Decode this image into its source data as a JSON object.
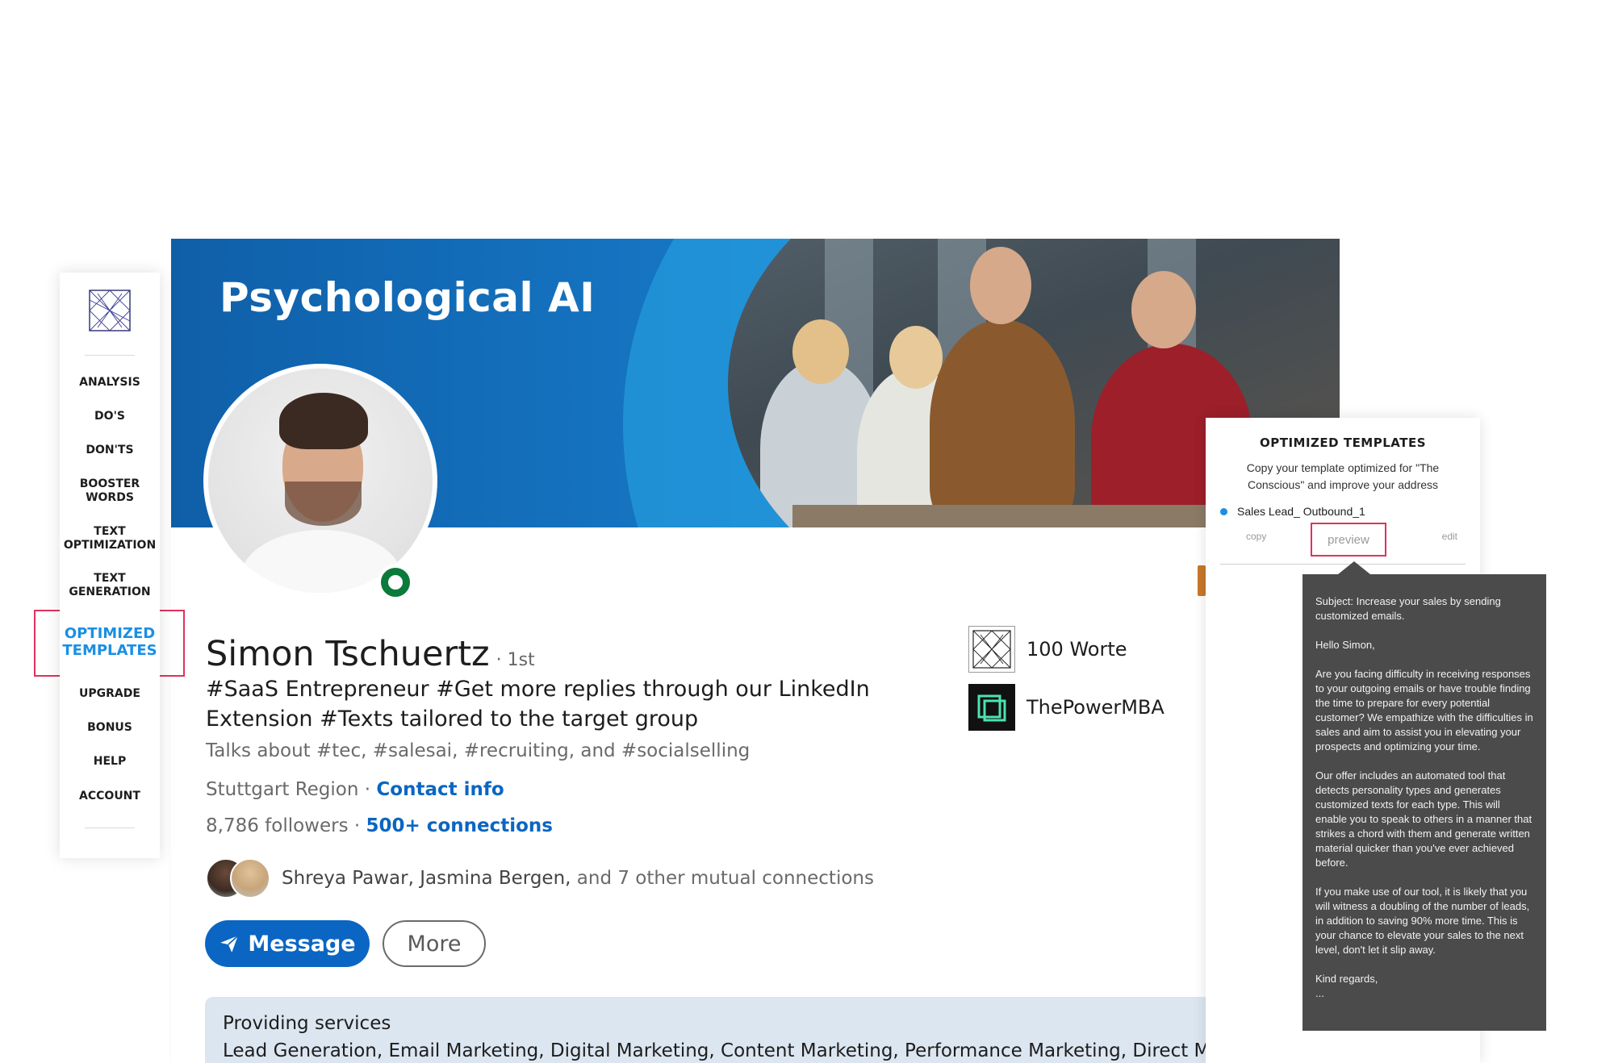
{
  "banner": {
    "title": "Psychological AI"
  },
  "profile": {
    "name": "Simon Tschuertz",
    "degree": "· 1st",
    "headline": "#SaaS Entrepreneur #Get more replies through our LinkedIn Extension #Texts tailored to the target group",
    "talks_about": "Talks about #tec, #salesai, #recruiting, and #socialselling",
    "location": "Stuttgart Region ·",
    "contact_info": "Contact info",
    "followers": "8,786 followers",
    "connections_sep": "·",
    "connections": "500+ connections",
    "mutual_names": "Shreya Pawar, Jasmina Bergen,",
    "mutual_rest": "and 7 other mutual connections",
    "message_button": "Message",
    "more_button": "More",
    "online_status_color": "#0b7a3b"
  },
  "companies": [
    {
      "name": "100 Worte",
      "icon": "worte-logo-icon"
    },
    {
      "name": "ThePowerMBA",
      "icon": "powermba-logo-icon"
    }
  ],
  "services": {
    "title": "Providing services",
    "list": "Lead Generation, Email Marketing, Digital Marketing, Content Marketing, Performance Marketing, Direct Mail M"
  },
  "sidebar": {
    "items": [
      {
        "label": "ANALYSIS"
      },
      {
        "label": "DO'S"
      },
      {
        "label": "DON'TS"
      },
      {
        "label": "BOOSTER\nWORDS"
      },
      {
        "label": "TEXT\nOPTIMIZATION"
      },
      {
        "label": "TEXT\nGENERATION"
      },
      {
        "label": "OPTIMIZED\nTEMPLATES"
      },
      {
        "label": "UPGRADE"
      },
      {
        "label": "BONUS"
      },
      {
        "label": "HELP"
      },
      {
        "label": "ACCOUNT"
      }
    ],
    "active_index": 6,
    "active_color": "#1a8fe3",
    "highlight_color": "#e0315e"
  },
  "templates": {
    "title": "OPTIMIZED TEMPLATES",
    "description": "Copy your template optimized for \"The Conscious\" and improve your address",
    "entry_name": "Sales Lead_ Outbound_1",
    "copy_label": "copy",
    "preview_label": "preview",
    "edit_label": "edit"
  },
  "preview_tooltip": {
    "paragraphs": [
      "Subject: Increase your sales by sending customized emails.",
      "Hello Simon,",
      "Are you facing difficulty in receiving responses to your outgoing emails or have trouble finding the time to prepare for every potential customer? We empathize with the difficulties in sales and aim to assist you in elevating your prospects and optimizing your time.",
      "Our offer includes an automated tool that detects personality types and generates customized texts for each type. This will enable you to speak to others in a manner that strikes a chord with them and generate written material quicker than you've ever achieved before.",
      "If you make use of our tool, it is likely that you will witness a doubling of the number of leads, in addition to saving 90% more time. This is your chance to elevate your sales to the next level, don't let it slip away.",
      "Kind regards,"
    ],
    "ellipsis": "..."
  },
  "colors": {
    "linkedin_blue": "#0a66c2",
    "tooltip_bg": "#4b4b4b"
  }
}
